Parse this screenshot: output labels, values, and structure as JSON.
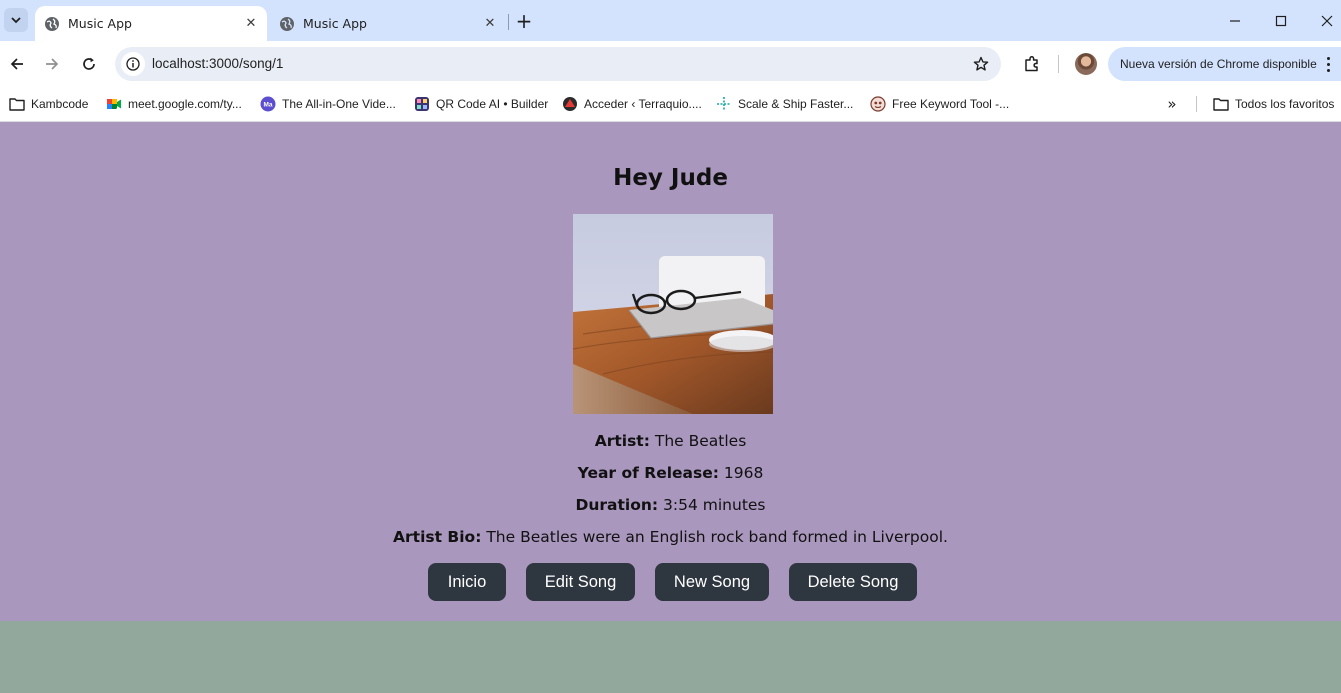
{
  "browser": {
    "tabs": [
      {
        "title": "Music App",
        "active": true
      },
      {
        "title": "Music App",
        "active": false
      }
    ],
    "url": "localhost:3000/song/1",
    "update_label": "Nueva versión de Chrome disponible",
    "bookmarks": [
      {
        "label": "Kambcode",
        "icon": "folder-icon"
      },
      {
        "label": "meet.google.com/ty...",
        "icon": "google-meet-icon"
      },
      {
        "label": "The All-in-One Vide...",
        "icon": "video-app-icon"
      },
      {
        "label": "QR Code AI • Builder",
        "icon": "qr-app-icon"
      },
      {
        "label": "Acceder ‹ Terraquio....",
        "icon": "terraquio-icon"
      },
      {
        "label": "Scale & Ship Faster...",
        "icon": "scale-ship-icon"
      },
      {
        "label": "Free Keyword Tool -...",
        "icon": "keyword-tool-icon"
      }
    ],
    "bookmarks_folder": "Todos los favoritos"
  },
  "song": {
    "title": "Hey Jude",
    "artist_label": "Artist:",
    "artist": "The Beatles",
    "year_label": "Year of Release:",
    "year": "1968",
    "duration_label": "Duration:",
    "duration": "3:54 minutes",
    "bio_label": "Artist Bio:",
    "bio": "The Beatles were an English rock band formed in Liverpool."
  },
  "actions": {
    "home": "Inicio",
    "edit": "Edit Song",
    "new": "New Song",
    "delete": "Delete Song"
  },
  "colors": {
    "page_background": "#aa97be",
    "body_background": "#93a89c",
    "button_background": "#2e3640",
    "tabstrip": "#d3e3fd"
  }
}
